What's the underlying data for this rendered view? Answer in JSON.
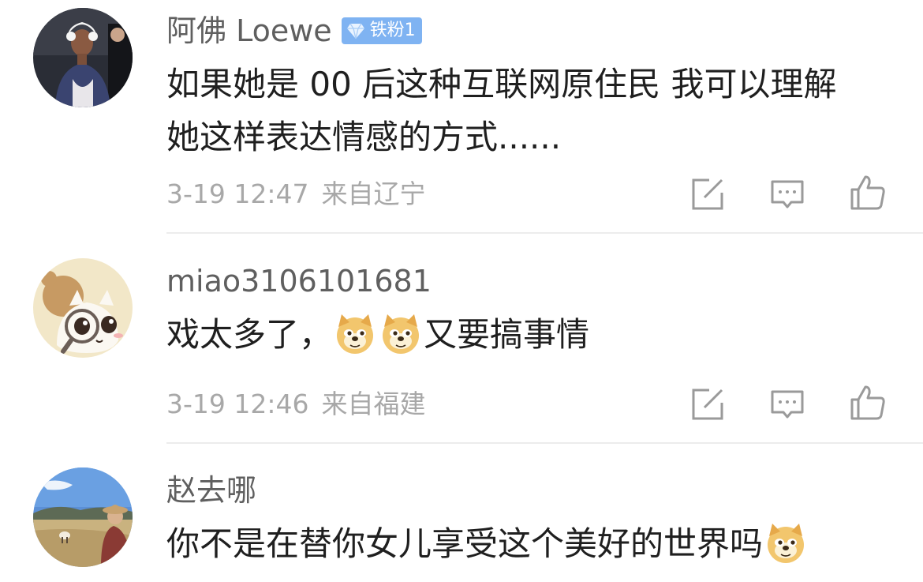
{
  "comments": [
    {
      "username": "阿佛 Loewe",
      "badge": "铁粉1",
      "text_line1": "如果她是 00 后这种互联网原住民 我可以理解",
      "text_line2": "她这样表达情感的方式......",
      "time": "3-19 12:47",
      "location": "来自辽宁"
    },
    {
      "username": "miao3106101681",
      "text_part1": "戏太多了，",
      "text_part2": "又要搞事情",
      "time": "3-19 12:46",
      "location": "来自福建"
    },
    {
      "username": "赵去哪",
      "text_part1": "你不是在替你女儿享受这个美好的世界吗"
    }
  ],
  "icons": {
    "repost": "share-edit-icon",
    "comment": "comment-bubble-icon",
    "like": "thumbs-up-icon",
    "emoji": "doge-emoji-icon",
    "badge": "diamond-icon"
  },
  "colors": {
    "badge_bg": "#7fb3f2",
    "username": "#5f5f5f",
    "meta": "#a8a8a8",
    "text": "#1f1f1f",
    "icon": "#9a9a9a"
  }
}
